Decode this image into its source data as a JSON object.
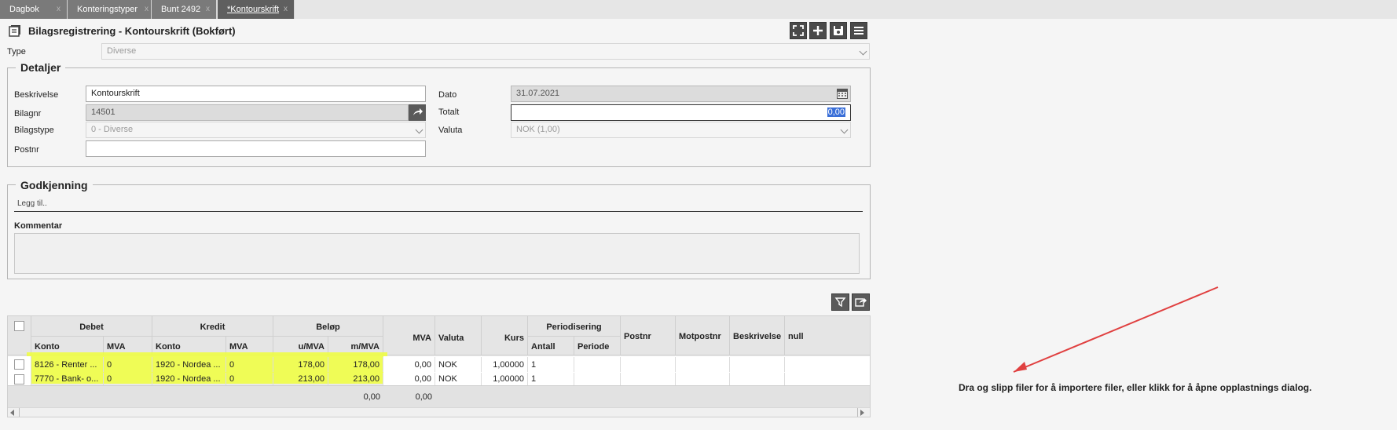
{
  "tabs": [
    {
      "label": "Dagbok"
    },
    {
      "label": "Konteringstyper"
    },
    {
      "label": "Bunt 2492"
    },
    {
      "label": "*Kontourskrift"
    }
  ],
  "tab_close": "x",
  "header": {
    "title": "Bilagsregistrering - Kontourskrift (Bokført)"
  },
  "type_field": {
    "label": "Type",
    "value": "Diverse"
  },
  "details": {
    "legend": "Detaljer",
    "beskrivelse": {
      "label": "Beskrivelse",
      "value": "Kontourskrift"
    },
    "bilagnr": {
      "label": "Bilagnr",
      "value": "14501"
    },
    "bilagstype": {
      "label": "Bilagstype",
      "value": "0 - Diverse"
    },
    "postnr": {
      "label": "Postnr",
      "value": ""
    },
    "dato": {
      "label": "Dato",
      "value": "31.07.2021"
    },
    "totalt": {
      "label": "Totalt",
      "value": "0,00"
    },
    "valuta": {
      "label": "Valuta",
      "value": "NOK (1,00)"
    }
  },
  "approval": {
    "legend": "Godkjenning",
    "add_placeholder": "Legg til..",
    "comment_label": "Kommentar"
  },
  "grid": {
    "groups": {
      "debet": "Debet",
      "kredit": "Kredit",
      "belop": "Beløp",
      "periodisering": "Periodisering"
    },
    "columns": {
      "konto": "Konto",
      "mva": "MVA",
      "umva": "u/MVA",
      "mmva": "m/MVA",
      "mva2": "MVA",
      "valuta": "Valuta",
      "kurs": "Kurs",
      "antall": "Antall",
      "periode": "Periode",
      "postnr": "Postnr",
      "motpostnr": "Motpostnr",
      "beskrivelse": "Beskrivelse",
      "null": "null"
    },
    "rows": [
      {
        "debet_konto": "8126 - Renter ...",
        "debet_mva": "0",
        "kredit_konto": "1920 - Nordea ...",
        "kredit_mva": "0",
        "umva": "178,00",
        "mmva": "178,00",
        "mva": "0,00",
        "valuta": "NOK",
        "kurs": "1,00000",
        "antall": "1"
      },
      {
        "debet_konto": "7770 - Bank- o...",
        "debet_mva": "0",
        "kredit_konto": "1920 - Nordea ...",
        "kredit_mva": "0",
        "umva": "213,00",
        "mmva": "213,00",
        "mva": "0,00",
        "valuta": "NOK",
        "kurs": "1,00000",
        "antall": "1"
      }
    ],
    "totals": {
      "mmva": "0,00",
      "mva": "0,00"
    }
  },
  "dropzone": {
    "text": "Dra og slipp filer for å importere filer, eller klikk for å åpne opplastnings dialog."
  },
  "colors": {
    "highlight": "#f0ff3c",
    "arrow": "#e04040",
    "button": "#4a4a4a",
    "selected_text": "#3a6fd8"
  }
}
